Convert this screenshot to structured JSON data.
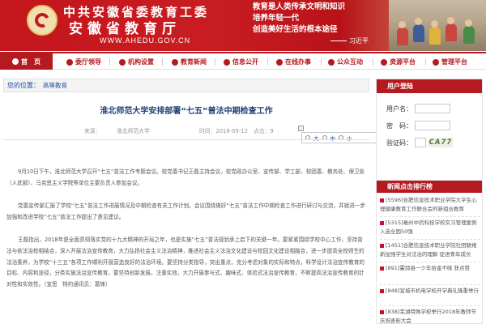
{
  "banner": {
    "title_line1": "中共安徽省委教育工委",
    "title_line2": "安徽省教育厅",
    "url": "WWW.AHEDU.GOV.CN",
    "quote": [
      "教育是人类传承文明和知识",
      "培养年轻一代",
      "创造美好生活的根本途径"
    ],
    "signature": "习近平",
    "colors": {
      "brand_red": "#b41a1f"
    }
  },
  "nav": {
    "items": [
      {
        "label": "首　页",
        "icon": "home-icon"
      },
      {
        "label": "委厅领导",
        "icon": "person-icon"
      },
      {
        "label": "机构设置",
        "icon": "org-icon"
      },
      {
        "label": "教育新闻",
        "icon": "news-icon"
      },
      {
        "label": "信息公开",
        "icon": "info-icon"
      },
      {
        "label": "在线办事",
        "icon": "online-icon"
      },
      {
        "label": "公众互动",
        "icon": "chat-icon"
      },
      {
        "label": "资源平台",
        "icon": "resource-icon"
      },
      {
        "label": "管理平台",
        "icon": "manage-icon"
      }
    ]
  },
  "breadcrumb": {
    "label": "您的位置：",
    "value": "高等教育"
  },
  "article": {
    "title": "淮北师范大学安排部署“七五”普法中期检查工作",
    "source": "来源：",
    "source_name": "淮北师范大学",
    "time": "时间：2018-09-12",
    "clicks": "点击：9",
    "font_options": [
      "大",
      "中",
      "小"
    ],
    "paragraphs": [
      "9月10日下午，淮北师范大学召开“七五”普法工作专题会议。校党委书记王磊主持会议，校党政办公室、宣传部、学工部、校团委、教务处、保卫处（人武部）、马克思主义学院等单位主要负责人参加会议。",
      "党委宣传部汇报了学校“七五”普法工作进展情况及中期检查有关工作计划。会议围绕做好“七五”普法工作中期检查工作进行研讨与交流，并就进一步加强和改进学校“七五”普法工作提出了意见建议。",
      "王磊指出，2018年是全面贯彻落实党的十九大精神的开局之年，也是实施“七五”普法规划承上启下的关键一年。要紧紧围绕学校中心工作，坚持普法与依法治校相结合，深入开展法治宣传教育，大力弘扬社会主义法治精神，推进社会主义法治文化建设与校园文化建设相融合，进一步提高全校师生的法治素养，为学校“十三五”各项工作顺利开展营造良好的法治环境。要坚持分类指导，突出重点，充分考虑对象的实际和特点，科学设计法治宣传教育的目标、内容和途径，分类实施法治宣传教育。要坚持创新发展，注重实效，大力开展参与式、趣味式、体验式法治宣传教育，不断提高法治宣传教育的针对性和实效性。（宣思　特约通讯员：葛锋）"
    ]
  },
  "login": {
    "header": "用户登陆",
    "username_label": "用户名：",
    "password_label": "密　码：",
    "captcha_label": "验证码：",
    "captcha_value": "CA77"
  },
  "ranking": {
    "header": "新闻点击排行榜",
    "items": [
      "[5596]合肥信息技术职业学院大学生心理健康教育工作联合会的新组合教育",
      "[5315]亳州中药科技学校实习管理案例入选全国50强",
      "[1451]合肥信息技术职业学院社团联络新加强学生对法治的理解 促进青年成长",
      "[891]霍邱县一少年拾金不昧 获点赞",
      "[848]宣城市机电学校开学典礼隆重举行",
      "[838]芜湖特殊学校举行2018年教师节庆祝表彰大会"
    ]
  }
}
